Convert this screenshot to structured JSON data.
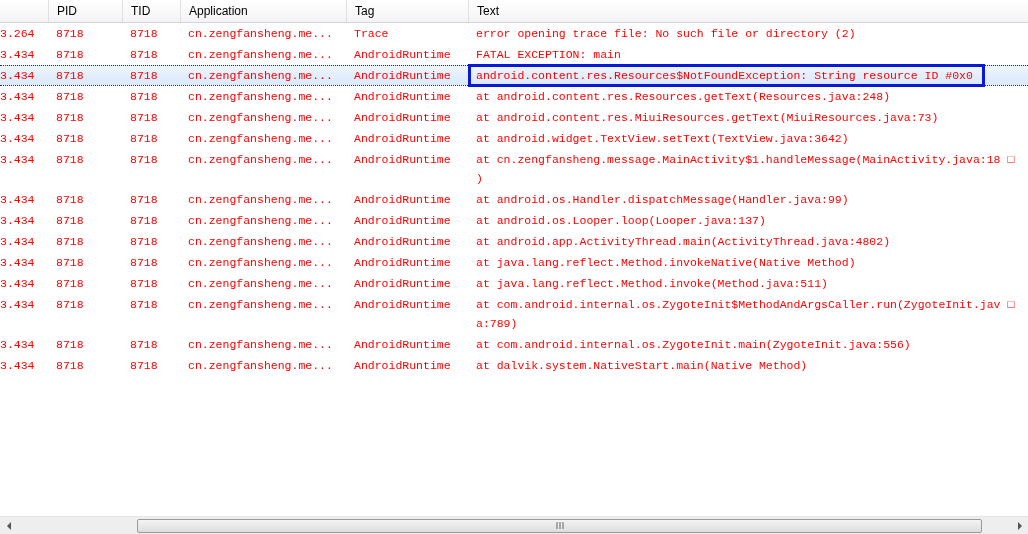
{
  "table": {
    "columns": [
      "PID",
      "TID",
      "Application",
      "Tag",
      "Text"
    ],
    "rows": [
      {
        "time": "3.264",
        "pid": "8718",
        "tid": "8718",
        "application": "cn.zengfansheng.me...",
        "tag": "Trace",
        "text": [
          "error opening trace file: No such file or directory (2)"
        ],
        "selected": false
      },
      {
        "time": "3.434",
        "pid": "8718",
        "tid": "8718",
        "application": "cn.zengfansheng.me...",
        "tag": "AndroidRuntime",
        "text": [
          "FATAL EXCEPTION: main"
        ],
        "selected": false
      },
      {
        "time": "3.434",
        "pid": "8718",
        "tid": "8718",
        "application": "cn.zengfansheng.me...",
        "tag": "AndroidRuntime",
        "text": [
          "android.content.res.Resources$NotFoundException: String resource ID #0x0"
        ],
        "selected": true
      },
      {
        "time": "3.434",
        "pid": "8718",
        "tid": "8718",
        "application": "cn.zengfansheng.me...",
        "tag": "AndroidRuntime",
        "text": [
          "at android.content.res.Resources.getText(Resources.java:248)"
        ],
        "selected": false
      },
      {
        "time": "3.434",
        "pid": "8718",
        "tid": "8718",
        "application": "cn.zengfansheng.me...",
        "tag": "AndroidRuntime",
        "text": [
          "at android.content.res.MiuiResources.getText(MiuiResources.java:73)"
        ],
        "selected": false
      },
      {
        "time": "3.434",
        "pid": "8718",
        "tid": "8718",
        "application": "cn.zengfansheng.me...",
        "tag": "AndroidRuntime",
        "text": [
          "at android.widget.TextView.setText(TextView.java:3642)"
        ],
        "selected": false
      },
      {
        "time": "3.434",
        "pid": "8718",
        "tid": "8718",
        "application": "cn.zengfansheng.me...",
        "tag": "AndroidRuntime",
        "text": [
          "at cn.zengfansheng.message.MainActivity$1.handleMessage(MainActivity.java:18 □",
          ")"
        ],
        "selected": false
      },
      {
        "time": "3.434",
        "pid": "8718",
        "tid": "8718",
        "application": "cn.zengfansheng.me...",
        "tag": "AndroidRuntime",
        "text": [
          "at android.os.Handler.dispatchMessage(Handler.java:99)"
        ],
        "selected": false
      },
      {
        "time": "3.434",
        "pid": "8718",
        "tid": "8718",
        "application": "cn.zengfansheng.me...",
        "tag": "AndroidRuntime",
        "text": [
          "at android.os.Looper.loop(Looper.java:137)"
        ],
        "selected": false
      },
      {
        "time": "3.434",
        "pid": "8718",
        "tid": "8718",
        "application": "cn.zengfansheng.me...",
        "tag": "AndroidRuntime",
        "text": [
          "at android.app.ActivityThread.main(ActivityThread.java:4802)"
        ],
        "selected": false
      },
      {
        "time": "3.434",
        "pid": "8718",
        "tid": "8718",
        "application": "cn.zengfansheng.me...",
        "tag": "AndroidRuntime",
        "text": [
          "at java.lang.reflect.Method.invokeNative(Native Method)"
        ],
        "selected": false
      },
      {
        "time": "3.434",
        "pid": "8718",
        "tid": "8718",
        "application": "cn.zengfansheng.me...",
        "tag": "AndroidRuntime",
        "text": [
          "at java.lang.reflect.Method.invoke(Method.java:511)"
        ],
        "selected": false
      },
      {
        "time": "3.434",
        "pid": "8718",
        "tid": "8718",
        "application": "cn.zengfansheng.me...",
        "tag": "AndroidRuntime",
        "text": [
          "at com.android.internal.os.ZygoteInit$MethodAndArgsCaller.run(ZygoteInit.jav □",
          "a:789)"
        ],
        "selected": false
      },
      {
        "time": "3.434",
        "pid": "8718",
        "tid": "8718",
        "application": "cn.zengfansheng.me...",
        "tag": "AndroidRuntime",
        "text": [
          "at com.android.internal.os.ZygoteInit.main(ZygoteInit.java:556)"
        ],
        "selected": false
      },
      {
        "time": "3.434",
        "pid": "8718",
        "tid": "8718",
        "application": "cn.zengfansheng.me...",
        "tag": "AndroidRuntime",
        "text": [
          "at dalvik.system.NativeStart.main(Native Method)"
        ],
        "selected": false
      }
    ]
  }
}
